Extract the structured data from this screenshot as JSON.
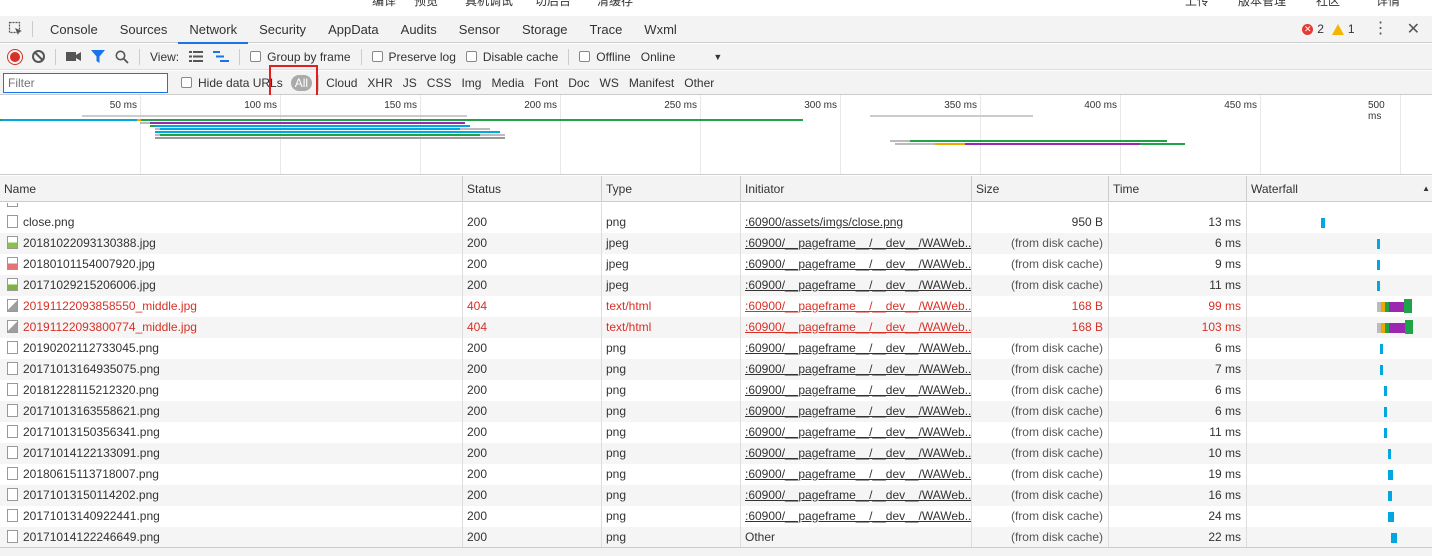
{
  "top_strip": [
    "编译",
    "预览",
    "真机调试",
    "切后台",
    "清缓存",
    "上传",
    "版本管理",
    "社区",
    "详情"
  ],
  "tabs": [
    "Console",
    "Sources",
    "Network",
    "Security",
    "AppData",
    "Audits",
    "Sensor",
    "Storage",
    "Trace",
    "Wxml"
  ],
  "active_tab": "Network",
  "status": {
    "errors": "2",
    "warnings": "1"
  },
  "toolbar": {
    "view_label": "View:",
    "group_by_frame": "Group by frame",
    "preserve_log": "Preserve log",
    "disable_cache": "Disable cache",
    "offline": "Offline",
    "throttle": "Online"
  },
  "filter": {
    "placeholder": "Filter",
    "hide_data_urls": "Hide data URLs",
    "types": [
      "All",
      "Cloud",
      "XHR",
      "JS",
      "CSS",
      "Img",
      "Media",
      "Font",
      "Doc",
      "WS",
      "Manifest",
      "Other"
    ]
  },
  "overview": {
    "ticks": [
      "50 ms",
      "100 ms",
      "150 ms",
      "200 ms",
      "250 ms",
      "300 ms",
      "350 ms",
      "400 ms",
      "450 ms",
      "500 ms"
    ]
  },
  "columns": {
    "name": "Name",
    "status": "Status",
    "type": "Type",
    "initiator": "Initiator",
    "size": "Size",
    "time": "Time",
    "waterfall": "Waterfall"
  },
  "rows": [
    {
      "name": "close.png",
      "status": "200",
      "type": "png",
      "initiator": ":60900/assets/imgs/close.png",
      "size": "950 B",
      "time": "13 ms",
      "icon": "file",
      "error": false,
      "wf": 0.2
    },
    {
      "name": "20181022093130388.jpg",
      "status": "200",
      "type": "jpeg",
      "initiator": ":60900/__pageframe__/__dev__/WAWeb...",
      "size": "(from disk cache)",
      "time": "6 ms",
      "icon": "img",
      "error": false,
      "wf": 0.35
    },
    {
      "name": "20180101154007920.jpg",
      "status": "200",
      "type": "jpeg",
      "initiator": ":60900/__pageframe__/__dev__/WAWeb...",
      "size": "(from disk cache)",
      "time": "9 ms",
      "icon": "img2",
      "error": false,
      "wf": 0.35
    },
    {
      "name": "20171029215206006.jpg",
      "status": "200",
      "type": "jpeg",
      "initiator": ":60900/__pageframe__/__dev__/WAWeb...",
      "size": "(from disk cache)",
      "time": "11 ms",
      "icon": "img3",
      "error": false,
      "wf": 0.35
    },
    {
      "name": "20191122093858550_middle.jpg",
      "status": "404",
      "type": "text/html",
      "initiator": ":60900/__pageframe__/__dev__/WAWeb...",
      "size": "168 B",
      "time": "99 ms",
      "icon": "broken",
      "error": true,
      "wf": 0.35
    },
    {
      "name": "20191122093800774_middle.jpg",
      "status": "404",
      "type": "text/html",
      "initiator": ":60900/__pageframe__/__dev__/WAWeb...",
      "size": "168 B",
      "time": "103 ms",
      "icon": "broken",
      "error": true,
      "wf": 0.35
    },
    {
      "name": "20190202112733045.png",
      "status": "200",
      "type": "png",
      "initiator": ":60900/__pageframe__/__dev__/WAWeb...",
      "size": "(from disk cache)",
      "time": "6 ms",
      "icon": "file",
      "error": false,
      "wf": 0.36
    },
    {
      "name": "20171013164935075.png",
      "status": "200",
      "type": "png",
      "initiator": ":60900/__pageframe__/__dev__/WAWeb...",
      "size": "(from disk cache)",
      "time": "7 ms",
      "icon": "file",
      "error": false,
      "wf": 0.36
    },
    {
      "name": "20181228115212320.png",
      "status": "200",
      "type": "png",
      "initiator": ":60900/__pageframe__/__dev__/WAWeb...",
      "size": "(from disk cache)",
      "time": "6 ms",
      "icon": "file",
      "error": false,
      "wf": 0.37
    },
    {
      "name": "20171013163558621.png",
      "status": "200",
      "type": "png",
      "initiator": ":60900/__pageframe__/__dev__/WAWeb...",
      "size": "(from disk cache)",
      "time": "6 ms",
      "icon": "file",
      "error": false,
      "wf": 0.37
    },
    {
      "name": "20171013150356341.png",
      "status": "200",
      "type": "png",
      "initiator": ":60900/__pageframe__/__dev__/WAWeb...",
      "size": "(from disk cache)",
      "time": "11 ms",
      "icon": "file",
      "error": false,
      "wf": 0.37
    },
    {
      "name": "20171014122133091.png",
      "status": "200",
      "type": "png",
      "initiator": ":60900/__pageframe__/__dev__/WAWeb...",
      "size": "(from disk cache)",
      "time": "10 ms",
      "icon": "file",
      "error": false,
      "wf": 0.38
    },
    {
      "name": "20180615113718007.png",
      "status": "200",
      "type": "png",
      "initiator": ":60900/__pageframe__/__dev__/WAWeb...",
      "size": "(from disk cache)",
      "time": "19 ms",
      "icon": "file",
      "error": false,
      "wf": 0.38
    },
    {
      "name": "20171013150114202.png",
      "status": "200",
      "type": "png",
      "initiator": ":60900/__pageframe__/__dev__/WAWeb...",
      "size": "(from disk cache)",
      "time": "16 ms",
      "icon": "file",
      "error": false,
      "wf": 0.38
    },
    {
      "name": "20171013140922441.png",
      "status": "200",
      "type": "png",
      "initiator": ":60900/__pageframe__/__dev__/WAWeb...",
      "size": "(from disk cache)",
      "time": "24 ms",
      "icon": "file",
      "error": false,
      "wf": 0.38
    },
    {
      "name": "20171014122246649.png",
      "status": "200",
      "type": "png",
      "initiator": "Other",
      "size": "(from disk cache)",
      "time": "22 ms",
      "icon": "file",
      "error": false,
      "wf": 0.39
    }
  ],
  "colors": {
    "accent": "#1a73e8",
    "error": "#d93025",
    "waiting": "#00a7e1",
    "receiving": "#1ea446",
    "stalled": "#9c27b0",
    "queued": "#f2a600"
  }
}
